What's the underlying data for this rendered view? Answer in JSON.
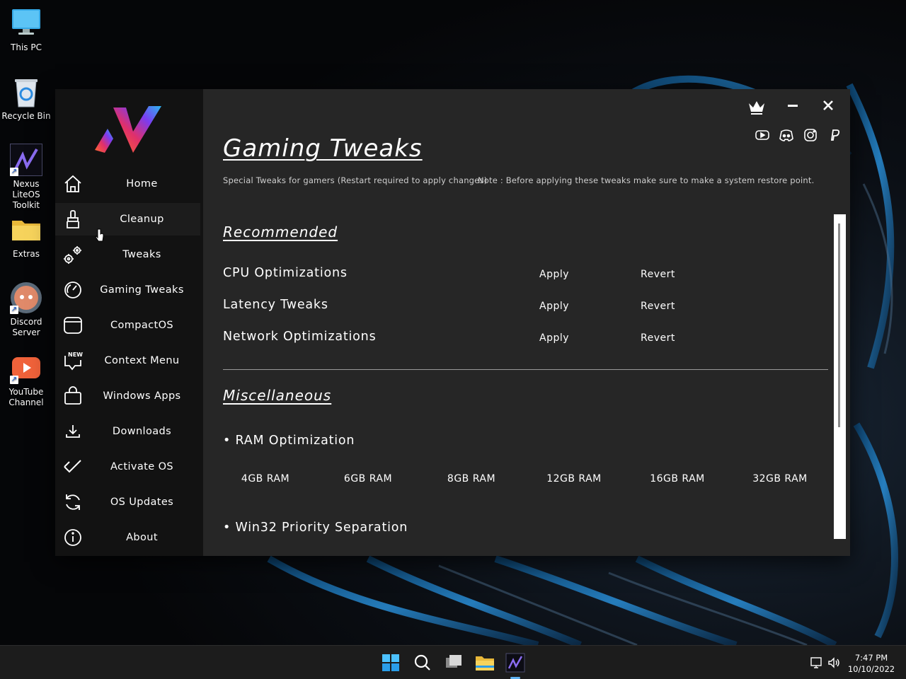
{
  "desktop": {
    "icons": [
      {
        "label": "This PC",
        "icon": "monitor-icon"
      },
      {
        "label": "Recycle Bin",
        "icon": "recycle-bin-icon"
      },
      {
        "label": "Nexus LiteOS Toolkit",
        "icon": "nexus-logo-icon"
      },
      {
        "label": "Extras",
        "icon": "folder-icon"
      },
      {
        "label": "Discord Server",
        "icon": "discord-icon"
      },
      {
        "label": "YouTube Channel",
        "icon": "youtube-icon"
      }
    ]
  },
  "app": {
    "sidebar": {
      "items": [
        {
          "label": "Home",
          "icon": "home-icon"
        },
        {
          "label": "Cleanup",
          "icon": "broom-icon"
        },
        {
          "label": "Tweaks",
          "icon": "gears-icon"
        },
        {
          "label": "Gaming Tweaks",
          "icon": "speedometer-icon"
        },
        {
          "label": "CompactOS",
          "icon": "rounded-square-icon"
        },
        {
          "label": "Context Menu",
          "icon": "new-chat-icon",
          "badge": "NEW!"
        },
        {
          "label": "Windows Apps",
          "icon": "shopping-bag-icon"
        },
        {
          "label": "Downloads",
          "icon": "download-icon"
        },
        {
          "label": "Activate OS",
          "icon": "checkmark-icon"
        },
        {
          "label": "OS Updates",
          "icon": "refresh-icon"
        },
        {
          "label": "About",
          "icon": "info-icon"
        }
      ],
      "active_index": 1
    },
    "window_controls": [
      "crown-icon",
      "minimize-icon",
      "close-icon"
    ],
    "socials": [
      "youtube-icon",
      "discord-icon",
      "instagram-icon",
      "paypal-icon"
    ],
    "main": {
      "title": "Gaming Tweaks",
      "subtitle": "Special Tweaks for gamers (Restart required to apply changes)",
      "note": "Note : Before applying these tweaks make sure to make a system restore point.",
      "recommended": {
        "heading": "Recommended",
        "rows": [
          {
            "name": "CPU Optimizations",
            "apply": "Apply",
            "revert": "Revert"
          },
          {
            "name": "Latency Tweaks",
            "apply": "Apply",
            "revert": "Revert"
          },
          {
            "name": "Network Optimizations",
            "apply": "Apply",
            "revert": "Revert"
          }
        ]
      },
      "misc": {
        "heading": "Miscellaneous",
        "ram_title": "• RAM Optimization",
        "ram_options": [
          "4GB RAM",
          "6GB RAM",
          "8GB RAM",
          "12GB RAM",
          "16GB RAM",
          "32GB RAM"
        ],
        "win32_title": "• Win32 Priority Separation"
      }
    }
  },
  "taskbar": {
    "apps": [
      "windows-start-icon",
      "search-icon",
      "task-view-icon",
      "file-explorer-icon",
      "nexus-toolkit-icon"
    ],
    "time": "7:47 PM",
    "date": "10/10/2022"
  },
  "colors": {
    "accent_blue": "#5fb2f2",
    "window_bg": "#262626",
    "sidebar_bg": "#121212"
  }
}
